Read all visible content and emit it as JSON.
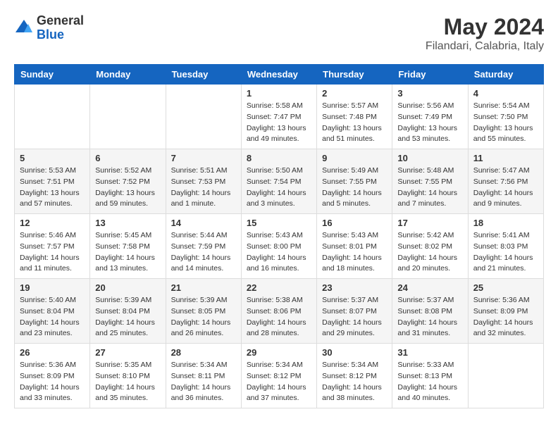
{
  "logo": {
    "general": "General",
    "blue": "Blue"
  },
  "header": {
    "month": "May 2024",
    "location": "Filandari, Calabria, Italy"
  },
  "weekdays": [
    "Sunday",
    "Monday",
    "Tuesday",
    "Wednesday",
    "Thursday",
    "Friday",
    "Saturday"
  ],
  "weeks": [
    [
      {
        "day": "",
        "info": ""
      },
      {
        "day": "",
        "info": ""
      },
      {
        "day": "",
        "info": ""
      },
      {
        "day": "1",
        "info": "Sunrise: 5:58 AM\nSunset: 7:47 PM\nDaylight: 13 hours\nand 49 minutes."
      },
      {
        "day": "2",
        "info": "Sunrise: 5:57 AM\nSunset: 7:48 PM\nDaylight: 13 hours\nand 51 minutes."
      },
      {
        "day": "3",
        "info": "Sunrise: 5:56 AM\nSunset: 7:49 PM\nDaylight: 13 hours\nand 53 minutes."
      },
      {
        "day": "4",
        "info": "Sunrise: 5:54 AM\nSunset: 7:50 PM\nDaylight: 13 hours\nand 55 minutes."
      }
    ],
    [
      {
        "day": "5",
        "info": "Sunrise: 5:53 AM\nSunset: 7:51 PM\nDaylight: 13 hours\nand 57 minutes."
      },
      {
        "day": "6",
        "info": "Sunrise: 5:52 AM\nSunset: 7:52 PM\nDaylight: 13 hours\nand 59 minutes."
      },
      {
        "day": "7",
        "info": "Sunrise: 5:51 AM\nSunset: 7:53 PM\nDaylight: 14 hours\nand 1 minute."
      },
      {
        "day": "8",
        "info": "Sunrise: 5:50 AM\nSunset: 7:54 PM\nDaylight: 14 hours\nand 3 minutes."
      },
      {
        "day": "9",
        "info": "Sunrise: 5:49 AM\nSunset: 7:55 PM\nDaylight: 14 hours\nand 5 minutes."
      },
      {
        "day": "10",
        "info": "Sunrise: 5:48 AM\nSunset: 7:55 PM\nDaylight: 14 hours\nand 7 minutes."
      },
      {
        "day": "11",
        "info": "Sunrise: 5:47 AM\nSunset: 7:56 PM\nDaylight: 14 hours\nand 9 minutes."
      }
    ],
    [
      {
        "day": "12",
        "info": "Sunrise: 5:46 AM\nSunset: 7:57 PM\nDaylight: 14 hours\nand 11 minutes."
      },
      {
        "day": "13",
        "info": "Sunrise: 5:45 AM\nSunset: 7:58 PM\nDaylight: 14 hours\nand 13 minutes."
      },
      {
        "day": "14",
        "info": "Sunrise: 5:44 AM\nSunset: 7:59 PM\nDaylight: 14 hours\nand 14 minutes."
      },
      {
        "day": "15",
        "info": "Sunrise: 5:43 AM\nSunset: 8:00 PM\nDaylight: 14 hours\nand 16 minutes."
      },
      {
        "day": "16",
        "info": "Sunrise: 5:43 AM\nSunset: 8:01 PM\nDaylight: 14 hours\nand 18 minutes."
      },
      {
        "day": "17",
        "info": "Sunrise: 5:42 AM\nSunset: 8:02 PM\nDaylight: 14 hours\nand 20 minutes."
      },
      {
        "day": "18",
        "info": "Sunrise: 5:41 AM\nSunset: 8:03 PM\nDaylight: 14 hours\nand 21 minutes."
      }
    ],
    [
      {
        "day": "19",
        "info": "Sunrise: 5:40 AM\nSunset: 8:04 PM\nDaylight: 14 hours\nand 23 minutes."
      },
      {
        "day": "20",
        "info": "Sunrise: 5:39 AM\nSunset: 8:04 PM\nDaylight: 14 hours\nand 25 minutes."
      },
      {
        "day": "21",
        "info": "Sunrise: 5:39 AM\nSunset: 8:05 PM\nDaylight: 14 hours\nand 26 minutes."
      },
      {
        "day": "22",
        "info": "Sunrise: 5:38 AM\nSunset: 8:06 PM\nDaylight: 14 hours\nand 28 minutes."
      },
      {
        "day": "23",
        "info": "Sunrise: 5:37 AM\nSunset: 8:07 PM\nDaylight: 14 hours\nand 29 minutes."
      },
      {
        "day": "24",
        "info": "Sunrise: 5:37 AM\nSunset: 8:08 PM\nDaylight: 14 hours\nand 31 minutes."
      },
      {
        "day": "25",
        "info": "Sunrise: 5:36 AM\nSunset: 8:09 PM\nDaylight: 14 hours\nand 32 minutes."
      }
    ],
    [
      {
        "day": "26",
        "info": "Sunrise: 5:36 AM\nSunset: 8:09 PM\nDaylight: 14 hours\nand 33 minutes."
      },
      {
        "day": "27",
        "info": "Sunrise: 5:35 AM\nSunset: 8:10 PM\nDaylight: 14 hours\nand 35 minutes."
      },
      {
        "day": "28",
        "info": "Sunrise: 5:34 AM\nSunset: 8:11 PM\nDaylight: 14 hours\nand 36 minutes."
      },
      {
        "day": "29",
        "info": "Sunrise: 5:34 AM\nSunset: 8:12 PM\nDaylight: 14 hours\nand 37 minutes."
      },
      {
        "day": "30",
        "info": "Sunrise: 5:34 AM\nSunset: 8:12 PM\nDaylight: 14 hours\nand 38 minutes."
      },
      {
        "day": "31",
        "info": "Sunrise: 5:33 AM\nSunset: 8:13 PM\nDaylight: 14 hours\nand 40 minutes."
      },
      {
        "day": "",
        "info": ""
      }
    ]
  ]
}
